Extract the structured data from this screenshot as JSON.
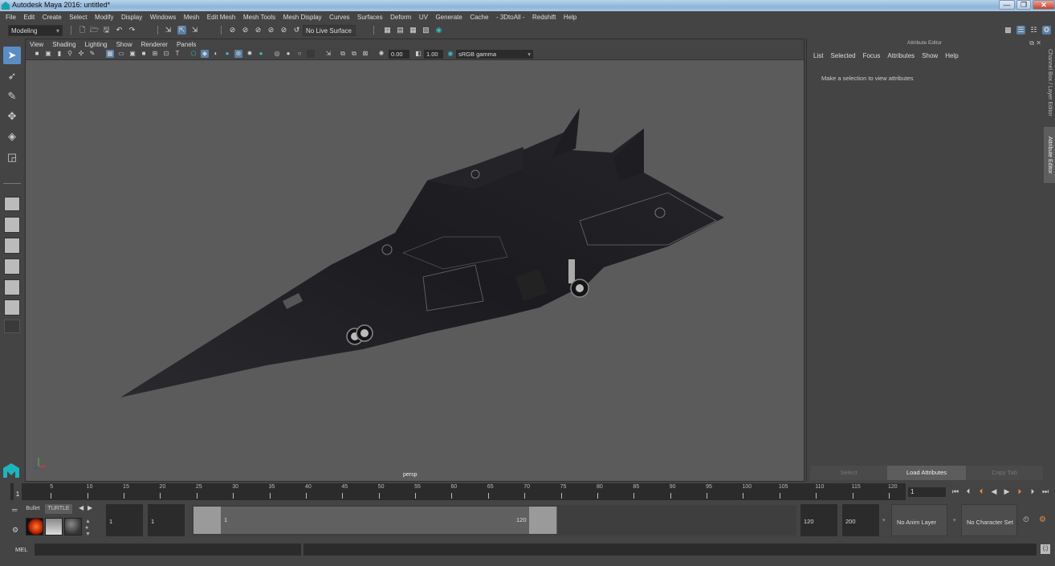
{
  "window": {
    "title": "Autodesk Maya 2016: untitled*",
    "controls": {
      "minimize": "—",
      "maximize": "❐",
      "close": "✕"
    }
  },
  "menubar": [
    "File",
    "Edit",
    "Create",
    "Select",
    "Modify",
    "Display",
    "Windows",
    "Mesh",
    "Edit Mesh",
    "Mesh Tools",
    "Mesh Display",
    "Curves",
    "Surfaces",
    "Deform",
    "UV",
    "Generate",
    "Cache",
    "- 3DtoAll -",
    "Redshift",
    "Help"
  ],
  "toolbar": {
    "menu_set": "Modeling",
    "live_surface": "No Live Surface",
    "icons": [
      "new-scene",
      "open-scene",
      "save-scene",
      "undo",
      "redo",
      "select-by-hierarchy",
      "select-by-object",
      "select-by-component",
      "snap-grid",
      "snap-curve",
      "snap-point",
      "snap-projected",
      "snap-view-plane",
      "make-live",
      "render-current-frame",
      "ipr-render",
      "render-settings",
      "hypershade",
      "render-view"
    ]
  },
  "toolbox": {
    "tools": [
      "select-tool",
      "lasso-tool",
      "paint-select-tool",
      "move-tool",
      "rotate-tool",
      "scale-tool"
    ],
    "active_tool": "select-tool"
  },
  "viewport": {
    "menu": [
      "View",
      "Shading",
      "Lighting",
      "Show",
      "Renderer",
      "Panels"
    ],
    "exposure": "0.00",
    "gamma": "1.00",
    "color_space": "sRGB gamma",
    "camera": "persp"
  },
  "attribute_editor": {
    "title": "Attribute Editor",
    "menu": [
      "List",
      "Selected",
      "Focus",
      "Attributes",
      "Show",
      "Help"
    ],
    "message": "Make a selection to view attributes",
    "buttons": {
      "select": "Select",
      "load": "Load Attributes",
      "copy_tab": "Copy Tab"
    },
    "side_tabs": {
      "channel_box": "Channel Box / Layer Editor",
      "attribute_editor": "Attribute Editor"
    }
  },
  "timeline": {
    "start": 1,
    "end": 120,
    "current_frame": "1",
    "tick_step": 5,
    "ticks": [
      "5",
      "10",
      "15",
      "20",
      "25",
      "30",
      "35",
      "40",
      "45",
      "50",
      "55",
      "60",
      "65",
      "70",
      "75",
      "80",
      "85",
      "90",
      "95",
      "100",
      "105",
      "110",
      "115",
      "120"
    ],
    "playback_icons": [
      "go-to-start",
      "step-back-frame",
      "step-back-key",
      "play-backward",
      "play-forward",
      "step-forward-key",
      "step-forward-frame",
      "go-to-end"
    ]
  },
  "range": {
    "anim_start": "1",
    "playback_start": "1",
    "range_start_label": "1",
    "range_end_label": "120",
    "playback_end": "120",
    "anim_end": "200",
    "anim_layer": "No Anim Layer",
    "character_set": "No Character Set"
  },
  "shelf": {
    "tabs": [
      "Bullet",
      "TURTLE"
    ],
    "active_tab": "TURTLE"
  },
  "command_line": {
    "label": "MEL",
    "value": ""
  }
}
